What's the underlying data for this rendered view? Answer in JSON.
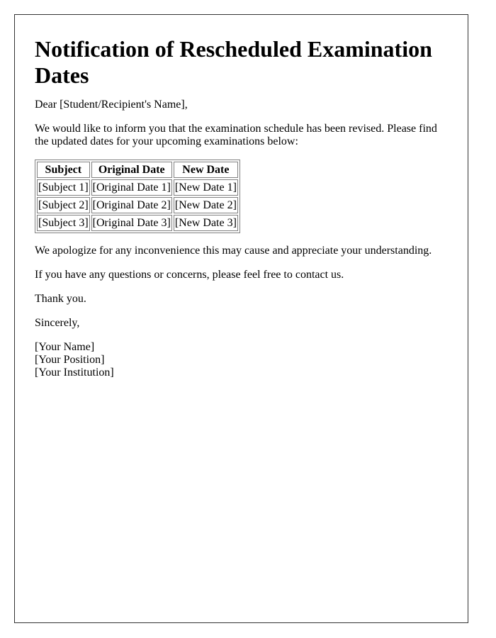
{
  "title": "Notification of Rescheduled Examination Dates",
  "greeting": "Dear [Student/Recipient's Name],",
  "intro": "We would like to inform you that the examination schedule has been revised. Please find the updated dates for your upcoming examinations below:",
  "table": {
    "headers": [
      "Subject",
      "Original Date",
      "New Date"
    ],
    "rows": [
      [
        "[Subject 1]",
        "[Original Date 1]",
        "[New Date 1]"
      ],
      [
        "[Subject 2]",
        "[Original Date 2]",
        "[New Date 2]"
      ],
      [
        "[Subject 3]",
        "[Original Date 3]",
        "[New Date 3]"
      ]
    ]
  },
  "apology": "We apologize for any inconvenience this may cause and appreciate your understanding.",
  "contact": "If you have any questions or concerns, please feel free to contact us.",
  "thanks": "Thank you.",
  "closing": "Sincerely,",
  "signature": {
    "name": "[Your Name]",
    "position": "[Your Position]",
    "institution": "[Your Institution]"
  }
}
